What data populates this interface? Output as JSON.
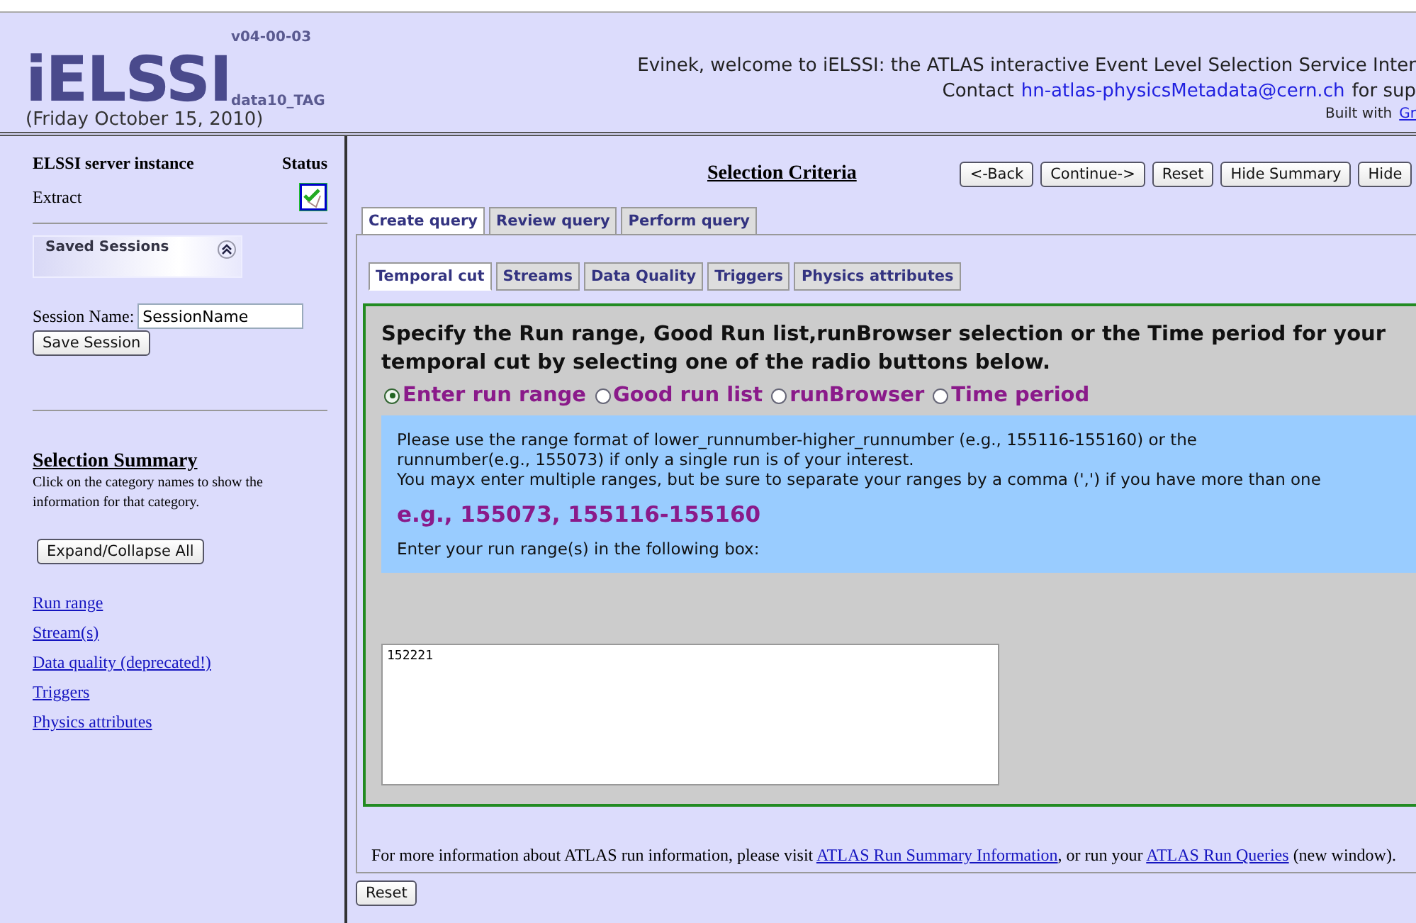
{
  "header": {
    "logo": "iELSSI",
    "version": "v04-00-03",
    "dataset": "data10_TAG",
    "date": "(Friday October 15, 2010)",
    "welcome": "Evinek, welcome to iELSSI: the ATLAS interactive Event Level Selection Service Inter",
    "contact_prefix": "Contact",
    "contact_email": "hn-atlas-physicsMetadata@cern.ch",
    "contact_suffix": "for sup",
    "built_prefix": "Built with",
    "built_link": "Gr"
  },
  "sidebar": {
    "server_heading": "ELSSI server instance",
    "status_heading": "Status",
    "instance": "Extract",
    "status_ok": true,
    "saved_sessions": {
      "title": "Saved Sessions",
      "expanded": true
    },
    "session_label": "Session Name:",
    "session_value": "SessionName",
    "save_button": "Save Session",
    "summary_title": "Selection Summary",
    "summary_hint": "Click on the category names to show the information for that category.",
    "expand_button": "Expand/Collapse All",
    "categories": [
      "Run range",
      "Stream(s)",
      "Data quality (deprecated!)",
      "Triggers",
      "Physics attributes"
    ]
  },
  "main": {
    "title": "Selection Criteria",
    "buttons": [
      "<-Back",
      "Continue->",
      "Reset",
      "Hide Summary",
      "Hide"
    ],
    "tabs": [
      {
        "label": "Create query",
        "selected": true
      },
      {
        "label": "Review query",
        "selected": false
      },
      {
        "label": "Perform query",
        "selected": false
      }
    ],
    "subtabs": [
      {
        "label": "Temporal cut",
        "selected": true
      },
      {
        "label": "Streams",
        "selected": false
      },
      {
        "label": "Data Quality",
        "selected": false
      },
      {
        "label": "Triggers",
        "selected": false
      },
      {
        "label": "Physics attributes",
        "selected": false
      }
    ],
    "instruction": "Specify the Run range, Good Run list,runBrowser selection or the Time period for your temporal cut by selecting one of the radio buttons below.",
    "radios": [
      {
        "label": "Enter run range",
        "selected": true
      },
      {
        "label": "Good run list",
        "selected": false
      },
      {
        "label": "runBrowser",
        "selected": false
      },
      {
        "label": "Time period",
        "selected": false
      }
    ],
    "info_lines": [
      "Please use the range format of lower_runnumber-higher_runnumber (e.g., 155116-155160) or the runnumber(e.g., 155073) if only a single run is of your interest.",
      "You mayx enter multiple ranges, but be sure to separate your ranges by a comma (',') if you have more than one"
    ],
    "example": "e.g., 155073, 155116-155160",
    "box_label": "Enter your run range(s) in the following box:",
    "run_range_value": "152221",
    "footer_prefix": "For more information about ATLAS run information, please visit",
    "footer_link1": "ATLAS Run Summary Information",
    "footer_middle": ", or run your",
    "footer_link2": "ATLAS Run Queries",
    "footer_suffix": "(new window).",
    "reset_button": "Reset"
  }
}
